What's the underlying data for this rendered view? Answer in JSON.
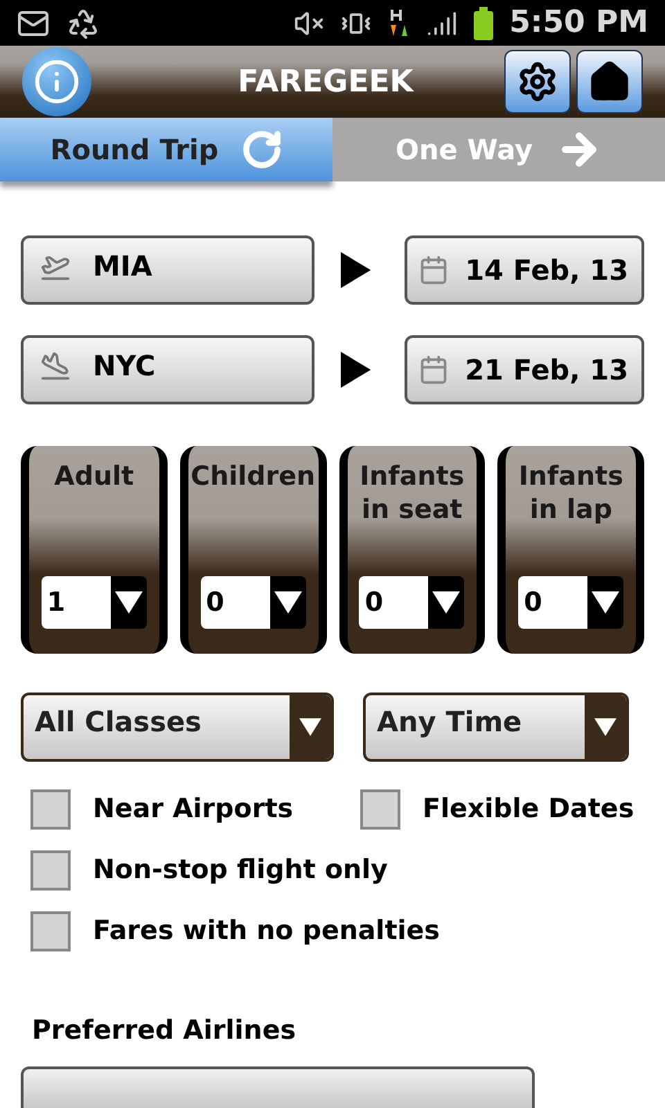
{
  "status_bar": {
    "time": "5:50 PM"
  },
  "header": {
    "title": "FAREGEEK"
  },
  "tabs": [
    {
      "label": "Round Trip",
      "selected": true,
      "kind": "round"
    },
    {
      "label": "One Way",
      "selected": false,
      "kind": "oneway"
    }
  ],
  "legs": [
    {
      "kind": "depart",
      "airport": "MIA",
      "date": "14 Feb, 13"
    },
    {
      "kind": "arrive",
      "airport": "NYC",
      "date": "21 Feb, 13"
    }
  ],
  "passengers": [
    {
      "label": "Adult",
      "value": "1"
    },
    {
      "label": "Children",
      "value": "0"
    },
    {
      "label": "Infants in seat",
      "value": "0"
    },
    {
      "label": "Infants in lap",
      "value": "0"
    }
  ],
  "selects": [
    {
      "value": "All Classes"
    },
    {
      "value": "Any Time"
    }
  ],
  "option_rows": [
    [
      {
        "label": "Near Airports",
        "checked": false
      },
      {
        "label": "Flexible Dates",
        "checked": false
      }
    ],
    [
      {
        "label": "Non-stop flight only",
        "checked": false
      }
    ],
    [
      {
        "label": "Fares with no penalties",
        "checked": false
      }
    ]
  ],
  "preferred_airlines": {
    "label": "Preferred Airlines"
  }
}
